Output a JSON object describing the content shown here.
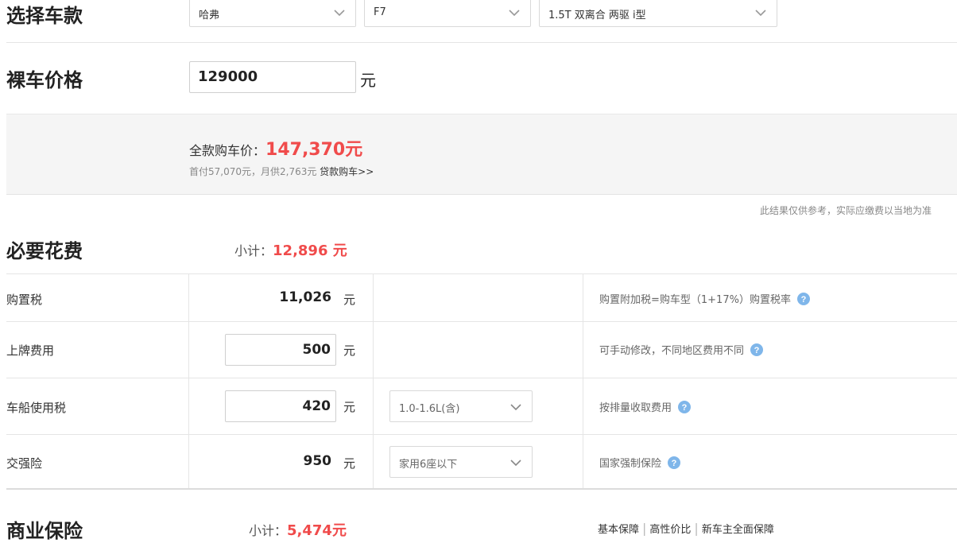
{
  "select_model": {
    "title": "选择车款",
    "brand": "哈弗",
    "series": "F7",
    "trim": "1.5T 双离合 两驱 i型"
  },
  "bare_price": {
    "title": "裸车价格",
    "value": "129000",
    "unit": "元"
  },
  "summary": {
    "full_label": "全款购车价：",
    "full_value": "147,370元",
    "loan_text": "首付57,070元，月供2,763元",
    "loan_link": "贷款购车>>"
  },
  "disclaimer": "此结果仅供参考，实际应缴费以当地为准",
  "required": {
    "title": "必要花费",
    "subtotal_label": "小计：",
    "subtotal_value": "12,896 元",
    "rows": [
      {
        "label": "购置税",
        "value": "11,026",
        "unit": "元",
        "note": "购置附加税=购车型（1+17%）购置税率"
      },
      {
        "label": "上牌费用",
        "value": "500",
        "unit": "元",
        "note": "可手动修改，不同地区费用不同"
      },
      {
        "label": "车船使用税",
        "value": "420",
        "unit": "元",
        "option": "1.0-1.6L(含)",
        "note": "按排量收取费用"
      },
      {
        "label": "交强险",
        "value": "950",
        "unit": "元",
        "option": "家用6座以下",
        "note": "国家强制保险"
      }
    ]
  },
  "commercial": {
    "title": "商业保险",
    "subtotal_label": "小计：",
    "subtotal_value": "5,474元",
    "tabs": [
      "基本保障",
      "高性价比",
      "新车主全面保障"
    ]
  },
  "colors": {
    "accent_red": "#f04b4b",
    "help_blue": "#7fb6ea"
  }
}
